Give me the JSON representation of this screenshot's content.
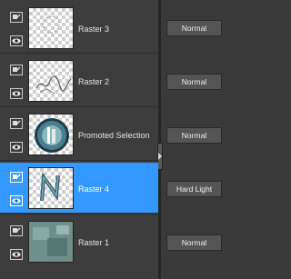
{
  "layers": [
    {
      "name": "Raster 3",
      "blend": "Normal",
      "selected": false
    },
    {
      "name": "Raster 2",
      "blend": "Normal",
      "selected": false
    },
    {
      "name": "Promoted Selection",
      "blend": "Normal",
      "selected": false
    },
    {
      "name": "Raster 4",
      "blend": "Hard Light",
      "selected": true
    },
    {
      "name": "Raster 1",
      "blend": "Normal",
      "selected": false
    }
  ],
  "colors": {
    "selection": "#3399ff",
    "panel": "#3c3c3c"
  },
  "icons": {
    "link": "link-icon",
    "visibility": "eye-icon"
  }
}
